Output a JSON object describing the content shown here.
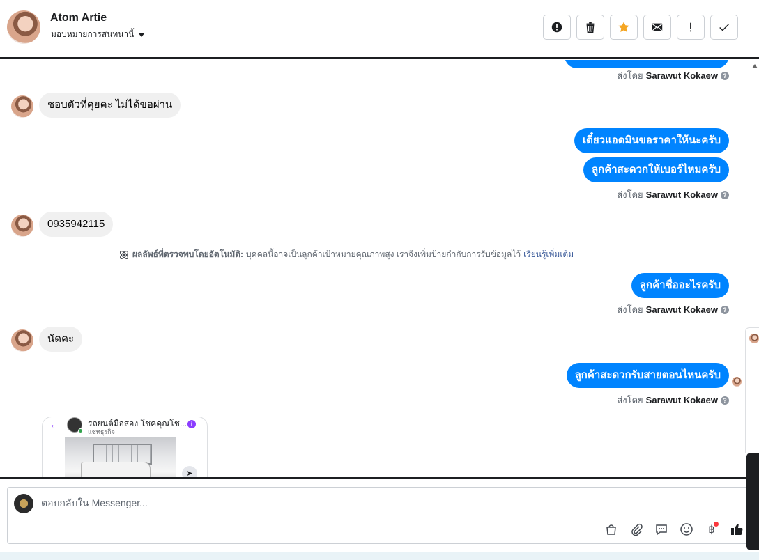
{
  "header": {
    "name": "Atom Artie",
    "assign_label": "มอบหมายการสนทนานี้",
    "toolbar": [
      {
        "name": "spam-button",
        "icon": "alert-circle-icon"
      },
      {
        "name": "delete-button",
        "icon": "trash-icon"
      },
      {
        "name": "star-button",
        "icon": "star-icon",
        "color": "#f5a623"
      },
      {
        "name": "mark-unread-button",
        "icon": "envelope-icon"
      },
      {
        "name": "follow-up-button",
        "icon": "exclamation-icon"
      },
      {
        "name": "mark-done-button",
        "icon": "checkmark-icon"
      }
    ]
  },
  "thread": {
    "sent_by_prefix": "ส่งโดย",
    "agent_name": "Sarawut Kokaew",
    "messages": [
      {
        "dir": "in",
        "text": "ชอบตัวที่คุยคะ ไม่ได้ขอผ่าน"
      },
      {
        "dir": "out",
        "text": "เดี๋ยวแอดมินขอราคาให้นะครับ"
      },
      {
        "dir": "out",
        "text": "ลูกค้าสะดวกให้เบอร์ไหมครับ"
      },
      {
        "dir": "in",
        "text": "0935942115"
      },
      {
        "dir": "out",
        "text": "ลูกค้าชื่ออะไรครับ"
      },
      {
        "dir": "in",
        "text": "นัดคะ"
      },
      {
        "dir": "out",
        "text": "ลูกค้าสะดวกรับสายตอนไหนครับ"
      }
    ],
    "auto_detect": {
      "bold": "ผลลัพธ์ที่ตรวจพบโดยอัตโนมัติ:",
      "text": "บุคคลนี้อาจเป็นลูกค้าเป้าหมายคุณภาพสูง เราจึงเพิ่มป้ายกำกับการรับข้อมูลไว้",
      "link": "เรียนรู้เพิ่มเติม"
    },
    "shared_card": {
      "title": "รถยนต์มือสอง โชคคุณโช...",
      "subtitle": "แชทธุรกิจ"
    }
  },
  "composer": {
    "placeholder": "ตอบกลับใน Messenger...",
    "actions": [
      "shopping-bag-icon",
      "paperclip-icon",
      "saved-replies-icon",
      "emoji-icon",
      "baht-payment-icon",
      "thumbs-up-icon"
    ]
  },
  "colors": {
    "outgoing_bubble": "#0084ff",
    "incoming_bubble": "#f0f0f0",
    "star": "#f5a623"
  }
}
